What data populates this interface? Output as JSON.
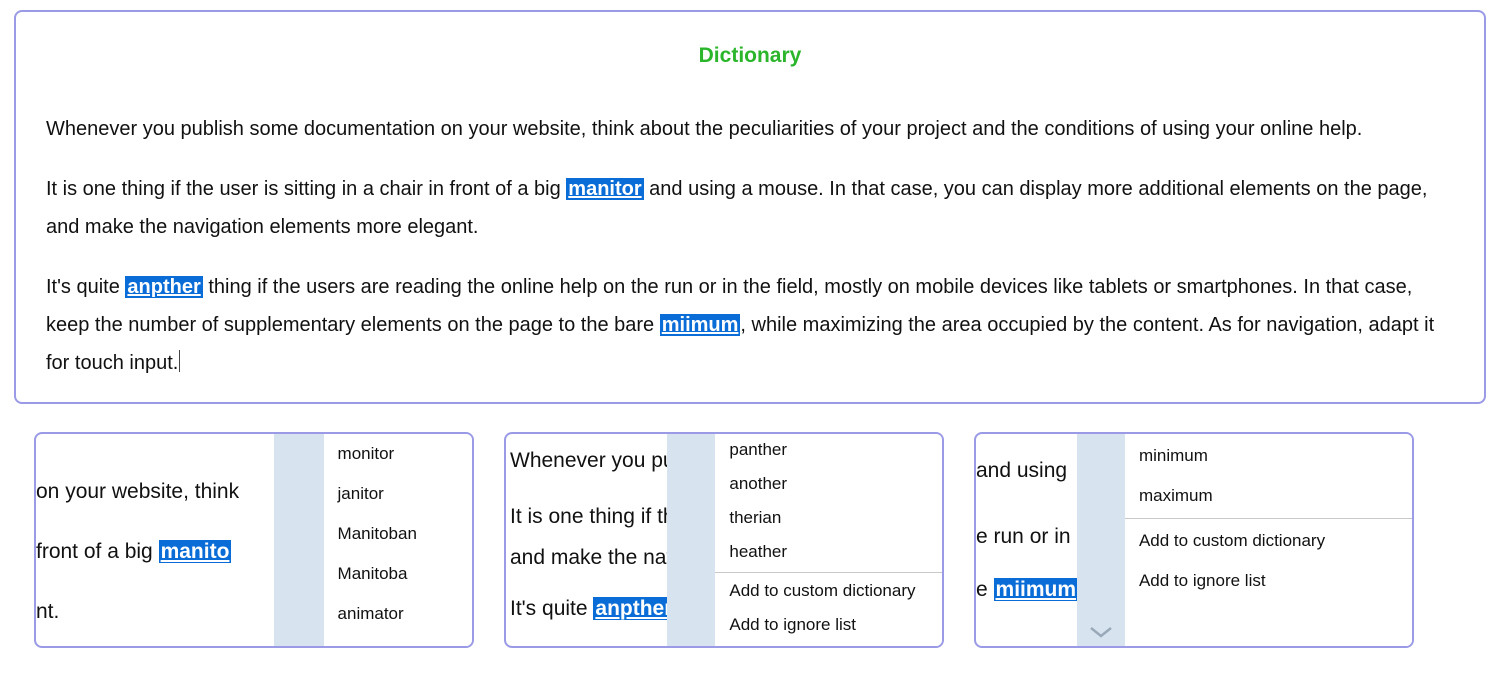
{
  "main": {
    "title": "Dictionary",
    "para1": "Whenever you publish some documentation on your website, think about the peculiarities of your project and the conditions of using your online help.",
    "para2_pre": "It is one thing if the user is sitting in a chair in front of a big ",
    "para2_miss": "manitor",
    "para2_post": " and using a mouse. In that case, you can display more additional elements on the page, and make the navigation elements more elegant.",
    "para3_pre": "It's quite ",
    "para3_miss1": "anpther",
    "para3_mid": " thing if the users are reading the online help on the run or in the field, mostly on mobile devices like tablets or smartphones. In that case, keep the number of supplementary elements on the page to the bare ",
    "para3_miss2": "miimum",
    "para3_post": ", while maximizing the area occupied by the content. As for navigation, adapt it for touch input."
  },
  "snippets": {
    "s1": {
      "lines": {
        "l1": "on your website, think",
        "l2_pre": "front of a big ",
        "l2_miss": "manito",
        "l3": "nt."
      },
      "menu": {
        "i0": "monitor",
        "i1": "janitor",
        "i2": "Manitoban",
        "i3": "Manitoba",
        "i4": "animator"
      }
    },
    "s2": {
      "lines": {
        "l1": "Whenever you pu",
        "l2": "It is one thing if th",
        "l3": "and make the navi",
        "l4_pre": "It's quite ",
        "l4_miss": "anpther"
      },
      "menu": {
        "i0": "panther",
        "i1": "another",
        "i2": "therian",
        "i3": "heather",
        "a0": "Add to custom dictionary",
        "a1": "Add to ignore list"
      }
    },
    "s3": {
      "lines": {
        "l1": "and using",
        "l2": "e run or in",
        "l3_pre": "e ",
        "l3_miss": "miimum"
      },
      "menu": {
        "i0": "minimum",
        "i1": "maximum",
        "a0": "Add to custom dictionary",
        "a1": "Add to ignore list"
      }
    }
  }
}
